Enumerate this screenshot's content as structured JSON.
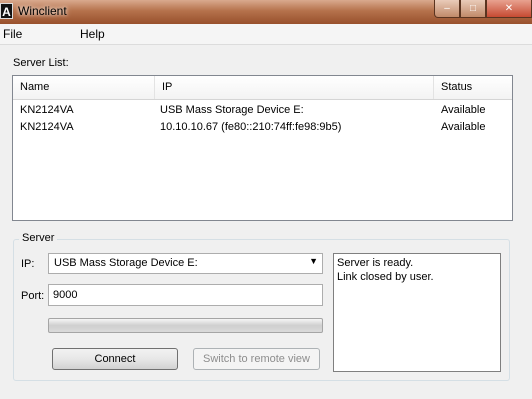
{
  "window": {
    "title": "Winclient",
    "app_icon_glyph": "A",
    "controls": {
      "minimize": "–",
      "maximize": "□",
      "close": "✕"
    }
  },
  "menu": {
    "file": "File",
    "help": "Help"
  },
  "server_list": {
    "label": "Server List:",
    "columns": {
      "name": "Name",
      "ip": "IP",
      "status": "Status"
    },
    "rows": [
      {
        "name": "KN2124VA",
        "ip": "USB Mass Storage Device E:",
        "status": "Available"
      },
      {
        "name": "KN2124VA",
        "ip": "10.10.10.67 (fe80::210:74ff:fe98:9b5)",
        "status": "Available"
      }
    ]
  },
  "server": {
    "group_label": "Server",
    "ip_label": "IP:",
    "ip_value": "USB Mass Storage Device E:",
    "port_label": "Port:",
    "port_value": "9000",
    "progress": 0,
    "connect_label": "Connect",
    "remote_label": "Switch to remote view",
    "status_lines": [
      "Server is ready.",
      "Link closed by user."
    ]
  }
}
